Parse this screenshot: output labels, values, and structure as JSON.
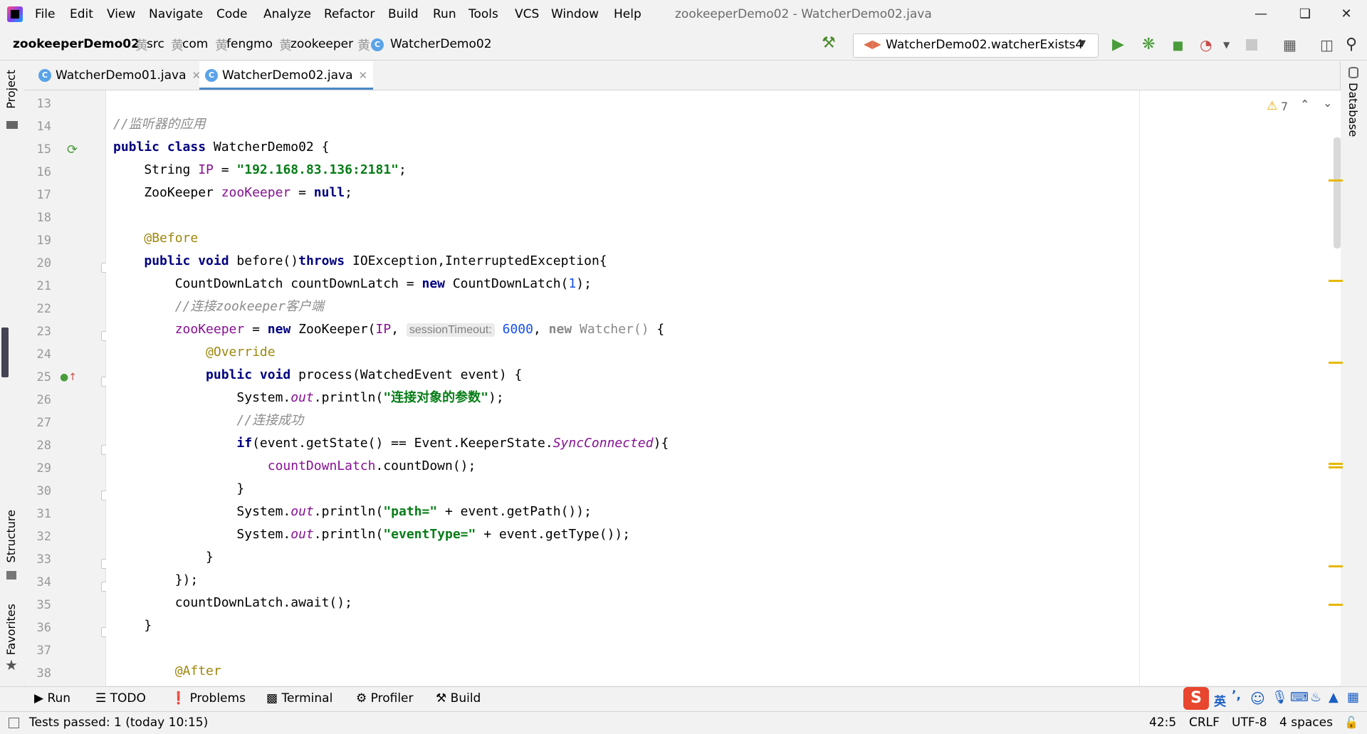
{
  "window": {
    "title": "zookeeperDemo02 - WatcherDemo02.java",
    "menu": [
      "File",
      "Edit",
      "View",
      "Navigate",
      "Code",
      "Analyze",
      "Refactor",
      "Build",
      "Run",
      "Tools",
      "VCS",
      "Window",
      "Help"
    ]
  },
  "breadcrumb": [
    "zookeeperDemo02",
    "src",
    "com",
    "fengmo",
    "zookeeper",
    "WatcherDemo02"
  ],
  "run_config": "WatcherDemo02.watcherExists4",
  "tabs": [
    {
      "label": "WatcherDemo01.java",
      "active": false
    },
    {
      "label": "WatcherDemo02.java",
      "active": true
    }
  ],
  "left_tools": [
    "Project",
    "Structure",
    "Favorites"
  ],
  "right_tools": [
    "Database"
  ],
  "inspection": {
    "warnings": "7"
  },
  "editor": {
    "line_numbers": [
      "13",
      "14",
      "15",
      "16",
      "17",
      "18",
      "19",
      "20",
      "21",
      "22",
      "23",
      "24",
      "25",
      "26",
      "27",
      "28",
      "29",
      "30",
      "31",
      "32",
      "33",
      "34",
      "35",
      "36",
      "37",
      "38"
    ],
    "lines": [
      "",
      "//监听器的应用",
      "public class WatcherDemo02 {",
      "    String IP = \"192.168.83.136:2181\";",
      "    ZooKeeper zooKeeper = null;",
      "",
      "    @Before",
      "    public void before()throws IOException,InterruptedException{",
      "        CountDownLatch countDownLatch = new CountDownLatch(1);",
      "        //连接zookeeper客户端",
      "        zooKeeper = new ZooKeeper(IP, sessionTimeout: 6000, new Watcher() {",
      "            @Override",
      "            public void process(WatchedEvent event) {",
      "                System.out.println(\"连接对象的参数\");",
      "                //连接成功",
      "                if(event.getState() == Event.KeeperState.SyncConnected){",
      "                    countDownLatch.countDown();",
      "                }",
      "                System.out.println(\"path=\" + event.getPath());",
      "                System.out.println(\"eventType=\" + event.getType());",
      "            }",
      "        });",
      "        countDownLatch.await();",
      "    }",
      "",
      "    @After"
    ]
  },
  "bottom_tools": [
    "Run",
    "TODO",
    "Problems",
    "Terminal",
    "Profiler",
    "Build"
  ],
  "status": {
    "message": "Tests passed: 1 (today 10:15)",
    "position": "42:5",
    "line_sep": "CRLF",
    "encoding": "UTF-8",
    "indent": "4 spaces"
  },
  "ime": {
    "lang": "英"
  },
  "colors": {
    "keyword": "#000080",
    "string": "#067d17",
    "number": "#1750eb",
    "comment": "#8c8c8c",
    "annotation": "#9e880d",
    "field": "#871094",
    "warning": "#e8b800"
  }
}
